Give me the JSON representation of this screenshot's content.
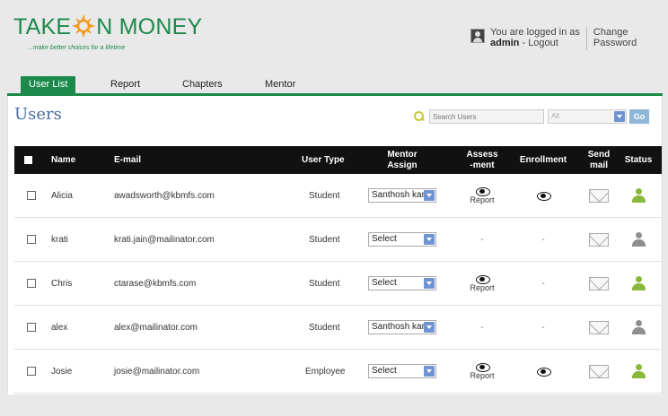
{
  "brand": {
    "logo_left": "TAKE",
    "logo_right": "N MONEY",
    "tagline": "...make better choices for a lifetime",
    "color": "#1d8a4b"
  },
  "account": {
    "logged_in_text": "You are logged in as",
    "username": "admin",
    "separator": " - ",
    "logout": "Logout",
    "change_password_line1": "Change",
    "change_password_line2": "Password"
  },
  "nav": {
    "tabs": [
      {
        "label": "User List",
        "active": true
      },
      {
        "label": "Report"
      },
      {
        "label": "Chapters"
      },
      {
        "label": "Mentor"
      }
    ]
  },
  "page": {
    "title": "Users",
    "search_placeholder": "Search Users",
    "filter_value": "All",
    "go_label": "Go"
  },
  "table": {
    "headers": {
      "name": "Name",
      "email": "E-mail",
      "user_type": "User Type",
      "mentor_assign_1": "Mentor",
      "mentor_assign_2": "Assign",
      "assessment_1": "Assess",
      "assessment_2": "-ment",
      "enrollment": "Enrollment",
      "send_mail_1": "Send",
      "send_mail_2": "mail",
      "status": "Status"
    },
    "report_label": "Report",
    "dash": "-",
    "rows": [
      {
        "name": "Alicia",
        "email": "awadsworth@kbmfs.com",
        "type": "Student",
        "mentor": "Santhosh kar",
        "assessment": true,
        "enrollment": true,
        "status": "active"
      },
      {
        "name": "krati",
        "email": "krati.jain@mailinator.com",
        "type": "Student",
        "mentor": "Select",
        "assessment": false,
        "enrollment": false,
        "status": "inactive"
      },
      {
        "name": "Chris",
        "email": "ctarase@kbmfs.com",
        "type": "Student",
        "mentor": "Select",
        "assessment": true,
        "enrollment": false,
        "status": "active"
      },
      {
        "name": "alex",
        "email": "alex@mailinator.com",
        "type": "Student",
        "mentor": "Santhosh kar",
        "assessment": false,
        "enrollment": false,
        "status": "inactive"
      },
      {
        "name": "Josie",
        "email": "josie@mailinator.com",
        "type": "Employee",
        "mentor": "Select",
        "assessment": true,
        "enrollment": true,
        "status": "active"
      }
    ]
  },
  "colors": {
    "active_status": "#8ab83a",
    "inactive_status": "#8f8f8f",
    "accent_blue": "#6f94d1"
  }
}
